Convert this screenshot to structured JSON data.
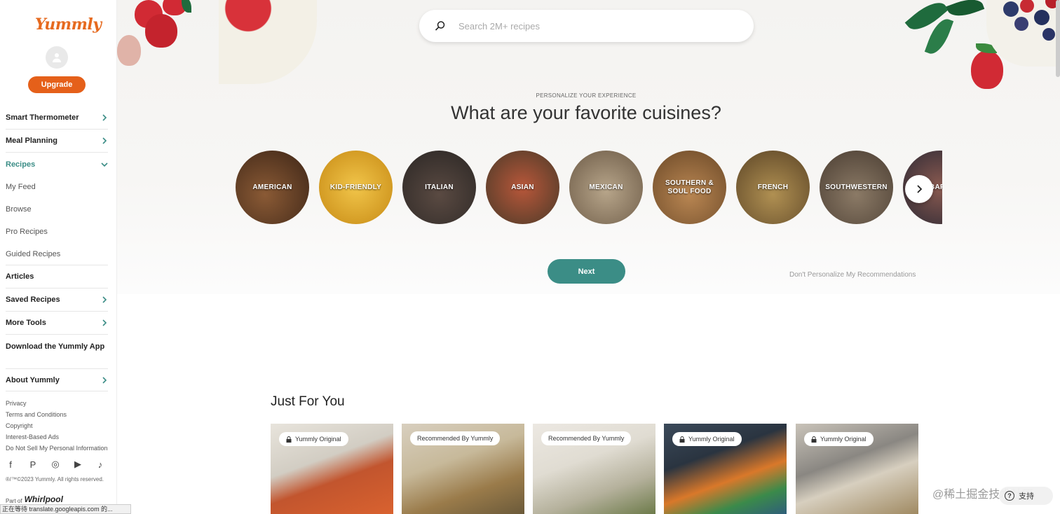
{
  "brand": {
    "logo_text": "Yummly",
    "accent": "#e5601a",
    "teal": "#3b8d86"
  },
  "sidebar": {
    "upgrade_label": "Upgrade",
    "nav": [
      {
        "label": "Smart Thermometer",
        "chevron": "right"
      },
      {
        "label": "Meal Planning",
        "chevron": "right"
      },
      {
        "label": "Recipes",
        "chevron": "down",
        "active": true
      }
    ],
    "recipes_sub": [
      "My Feed",
      "Browse",
      "Pro Recipes",
      "Guided Recipes"
    ],
    "nav2": [
      {
        "label": "Articles",
        "chevron": ""
      },
      {
        "label": "Saved Recipes",
        "chevron": "right"
      },
      {
        "label": "More Tools",
        "chevron": "right"
      },
      {
        "label": "Download the Yummly App",
        "chevron": ""
      }
    ],
    "about_label": "About Yummly",
    "links": [
      "Privacy",
      "Terms and Conditions",
      "Copyright",
      "Interest-Based Ads",
      "Do Not Sell My Personal Information"
    ],
    "social_icons": [
      "facebook-icon",
      "pinterest-icon",
      "instagram-icon",
      "youtube-icon",
      "tiktok-icon"
    ],
    "copyright": "®/™©2023 Yummly. All rights reserved.",
    "part_of_label": "Part of",
    "part_of_brand": "Whirlpool"
  },
  "search": {
    "placeholder": "Search 2M+ recipes"
  },
  "personalize": {
    "eyebrow": "PERSONALIZE YOUR EXPERIENCE",
    "headline": "What are your favorite cuisines?",
    "cuisines": [
      "AMERICAN",
      "KID-FRIENDLY",
      "ITALIAN",
      "ASIAN",
      "MEXICAN",
      "SOUTHERN & SOUL FOOD",
      "FRENCH",
      "SOUTHWESTERN",
      "BARBECUE"
    ],
    "next_label": "Next",
    "skip_label": "Don't Personalize My Recommendations"
  },
  "just_for_you": {
    "title": "Just For You",
    "cards": [
      {
        "badge": "Yummly Original",
        "locked": true
      },
      {
        "badge": "Recommended By Yummly",
        "locked": false
      },
      {
        "badge": "Recommended By Yummly",
        "locked": false
      },
      {
        "badge": "Yummly Original",
        "locked": true
      },
      {
        "badge": "Yummly Original",
        "locked": true
      }
    ]
  },
  "browser": {
    "status_text": "正在等待 translate.googleapis.com 的...",
    "watermark": "@稀土掘金技术社区",
    "help_label": "支持"
  }
}
